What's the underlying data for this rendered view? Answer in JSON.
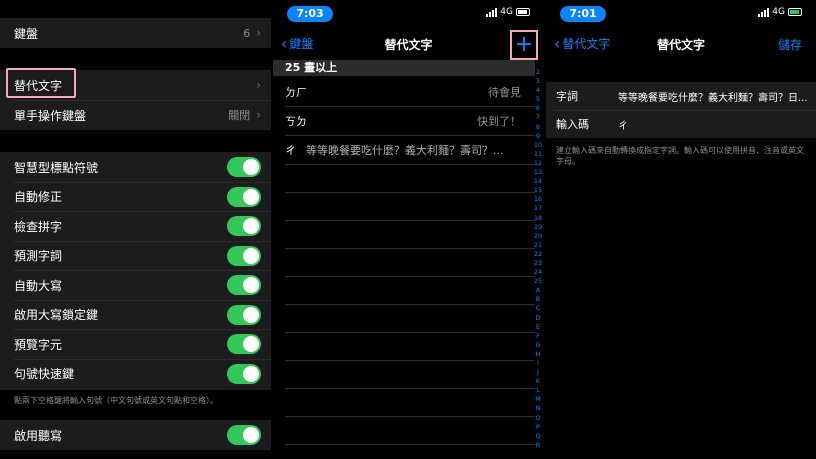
{
  "settings": {
    "keyboards_label": "鍵盤",
    "keyboards_count": "6",
    "text_replacement_label": "替代文字",
    "one_handed_label": "單手操作鍵盤",
    "one_handed_value": "關閉",
    "toggles": [
      {
        "label": "智慧型標點符號",
        "on": true
      },
      {
        "label": "自動修正",
        "on": true
      },
      {
        "label": "檢查拼字",
        "on": true
      },
      {
        "label": "預測字詞",
        "on": true
      },
      {
        "label": "自動大寫",
        "on": true
      },
      {
        "label": "啟用大寫鎖定鍵",
        "on": true
      },
      {
        "label": "預覽字元",
        "on": true
      },
      {
        "label": "句號快速鍵",
        "on": true
      }
    ],
    "footnote": "點兩下空格鍵將輸入句號（中文句號或英文句點和空格）。",
    "dictation_label": "啟用聽寫",
    "chevron": "›"
  },
  "list_screen": {
    "time": "7:03",
    "network": "4G",
    "back_label": "鍵盤",
    "title": "替代文字",
    "add_glyph": "+",
    "section_header": "25 畫以上",
    "entries": [
      {
        "shortcut": "ㄉㄏ",
        "phrase": "待會見"
      },
      {
        "shortcut": "ㄎㄉ",
        "phrase": "快到了！"
      },
      {
        "shortcut": "ㄔ",
        "phrase": "等等晚餐要吃什麼？義大利麵？壽司？..."
      }
    ],
    "index": [
      "2",
      "3",
      "4",
      "5",
      "6",
      "7",
      "8",
      "9",
      "10",
      "11",
      "12",
      "13",
      "14",
      "15",
      "16",
      "17",
      "18",
      "19",
      "20",
      "21",
      "22",
      "23",
      "24",
      "25",
      "A",
      "B",
      "C",
      "D",
      "E",
      "F",
      "G",
      "H",
      "I",
      "J",
      "K",
      "L",
      "M",
      "N",
      "O",
      "P",
      "Q",
      "R"
    ]
  },
  "edit_screen": {
    "time": "7:01",
    "network": "4G",
    "back_label": "替代文字",
    "title": "替代文字",
    "save_label": "儲存",
    "phrase_label": "字詞",
    "phrase_value": "等等晚餐要吃什麼？義大利麵？壽司？日...",
    "shortcut_label": "輸入碼",
    "shortcut_value": "ㄔ",
    "hint": "建立輸入碼來自動轉換成指定字詞。輸入碼可以使用拼音、注音或英文字母。"
  },
  "colors": {
    "accent": "#0a84ff",
    "toggle_on": "#34c759",
    "highlight": "#f4a7c0",
    "cell_bg": "#1c1c1e"
  }
}
